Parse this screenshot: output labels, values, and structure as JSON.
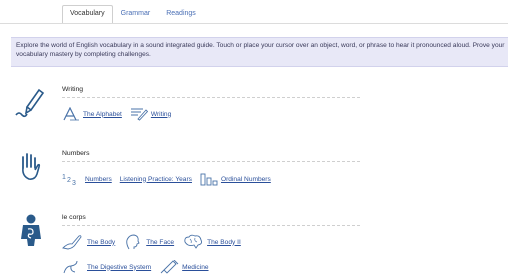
{
  "tabs": [
    {
      "label": "Vocabulary",
      "active": true
    },
    {
      "label": "Grammar",
      "active": false
    },
    {
      "label": "Readings",
      "active": false
    }
  ],
  "intro_text": "Explore the world of English vocabulary in a sound integrated guide. Touch or place your cursor over an object, word, or phrase to hear it pronounced aloud. Prove your vocabulary mastery by completing challenges.",
  "sections": {
    "writing": {
      "title": "Writing",
      "links": [
        {
          "label": "The Alphabet",
          "icon": "alphabet-icon"
        },
        {
          "label": "Writing",
          "icon": "pencil-paper-icon"
        }
      ]
    },
    "numbers": {
      "title": "Numbers",
      "links": [
        {
          "label": "Numbers",
          "icon": "numbers-123-icon"
        },
        {
          "label": "Listening Practice: Years",
          "icon": ""
        },
        {
          "label": "Ordinal Numbers",
          "icon": "ordinal-bars-icon"
        }
      ]
    },
    "body": {
      "title": "le corps",
      "links": [
        {
          "label": "The Body",
          "icon": "body-outline-icon"
        },
        {
          "label": "The Face",
          "icon": "face-profile-icon"
        },
        {
          "label": "The Body II",
          "icon": "brain-icon"
        },
        {
          "label": "The Digestive System",
          "icon": "digestive-icon"
        },
        {
          "label": "Medicine",
          "icon": "syringe-icon"
        }
      ]
    }
  },
  "colors": {
    "link": "#2a4f9a",
    "icon_blue": "#2a5a8a",
    "intro_bg": "#e8e8f7"
  }
}
